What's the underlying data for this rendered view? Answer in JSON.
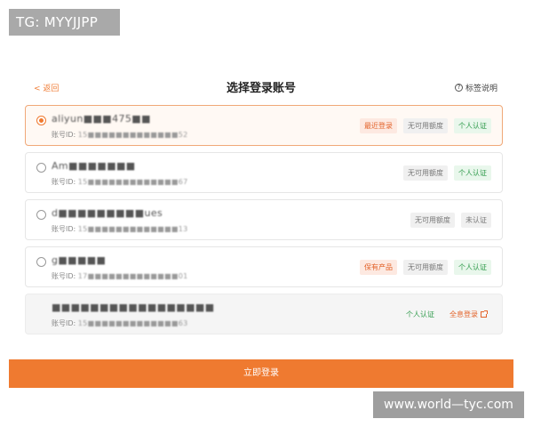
{
  "watermarks": {
    "top_left": "TG: MYYJJPP",
    "bottom_right": "www.world—tyc.com"
  },
  "header": {
    "back_label": "< 返回",
    "title": "选择登录账号",
    "tag_help_label": "标签说明",
    "help_icon": "question-circle-icon"
  },
  "accounts": [
    {
      "name": "aliyun■■■475■■",
      "id_label": "账号ID:",
      "id_value": "15■■■■■■■■■■■■■52",
      "selected": true,
      "tags": [
        "最近登录",
        "无可用额度",
        "个人认证"
      ]
    },
    {
      "name": "Am■■■■■■■",
      "id_label": "账号ID:",
      "id_value": "15■■■■■■■■■■■■■67",
      "selected": false,
      "tags": [
        "无可用额度",
        "个人认证"
      ]
    },
    {
      "name": "d■■■■■■■■■ues",
      "id_label": "账号ID:",
      "id_value": "15■■■■■■■■■■■■■13",
      "selected": false,
      "tags": [
        "无可用额度",
        "未认证"
      ]
    },
    {
      "name": "g■■■■■",
      "id_label": "账号ID:",
      "id_value": "17■■■■■■■■■■■■■01",
      "selected": false,
      "tags": [
        "保有产品",
        "无可用额度",
        "个人认证"
      ]
    },
    {
      "name": "■■■■■■■■■■■■■■■■■",
      "id_label": "账号ID:",
      "id_value": "15■■■■■■■■■■■■■63",
      "selected": false,
      "disabled": true,
      "tags": [
        "个人认证",
        "全息登录"
      ]
    }
  ],
  "login_button_label": "立即登录",
  "colors": {
    "accent": "#ef7a30",
    "tag_orange": "#e3632a",
    "tag_green": "#2e9a4a",
    "tag_gray": "#777777"
  }
}
